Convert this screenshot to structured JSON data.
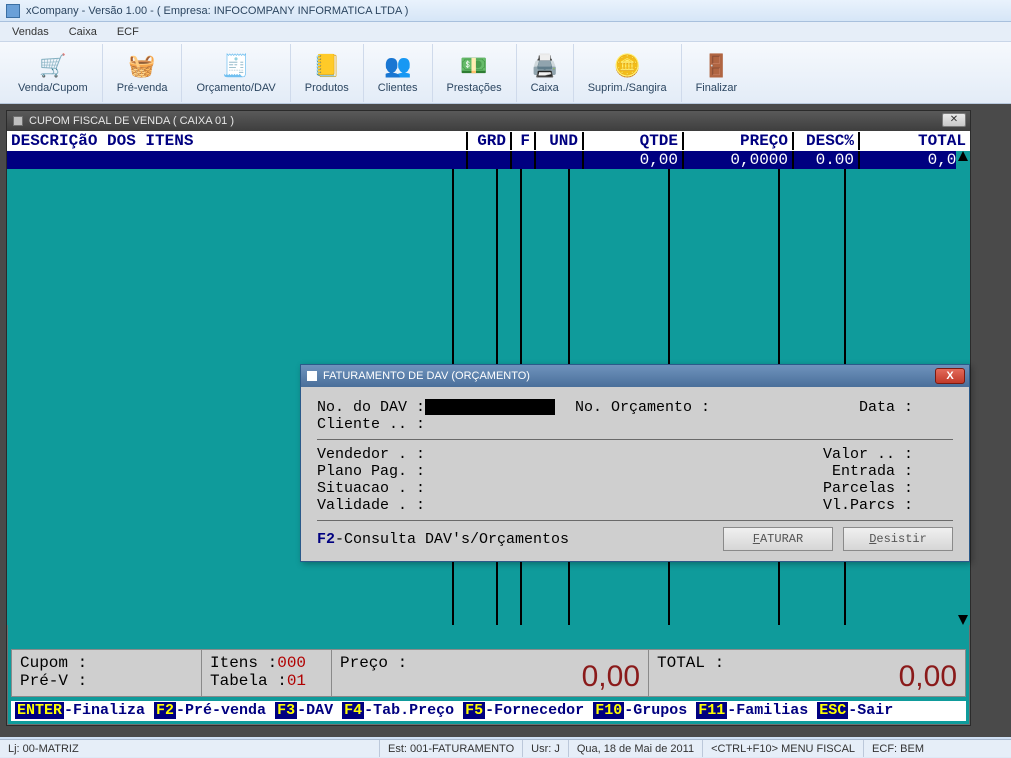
{
  "titlebar": "xCompany - Versão 1.00  -  ( Empresa: INFOCOMPANY INFORMATICA LTDA )",
  "menu": [
    "Vendas",
    "Caixa",
    "ECF"
  ],
  "toolbar": [
    {
      "label": "Venda/Cupom",
      "icon": "🛒"
    },
    {
      "label": "Pré-venda",
      "icon": "🧺"
    },
    {
      "label": "Orçamento/DAV",
      "icon": "🧾"
    },
    {
      "label": "Produtos",
      "icon": "📒"
    },
    {
      "label": "Clientes",
      "icon": "👥"
    },
    {
      "label": "Prestações",
      "icon": "💵"
    },
    {
      "label": "Caixa",
      "icon": "🖨️"
    },
    {
      "label": "Suprim./Sangira",
      "icon": "🪙"
    },
    {
      "label": "Finalizar",
      "icon": "🚪"
    }
  ],
  "fiscal": {
    "title": "CUPOM FISCAL DE VENDA    ( CAIXA 01 )",
    "headers": {
      "desc": "DESCRIÇãO DOS ITENS",
      "grd": "GRD",
      "f": "F",
      "und": "UND",
      "qtde": "QTDE",
      "preco": "PREÇO",
      "desc_pct": "DESC%",
      "total": "TOTAL"
    },
    "row0": {
      "qtde": "0,00",
      "preco": "0,0000",
      "desc_pct": "0.00",
      "total": "0,00"
    }
  },
  "bottom": {
    "cupom_lbl": "Cupom :",
    "prev_lbl": "Pré-V :",
    "itens_lbl": "Itens  :",
    "itens_val": "000",
    "tabela_lbl": "Tabela :",
    "tabela_val": "01",
    "preco_lbl": "Preço :",
    "preco_val": "0,00",
    "total_lbl": "TOTAL :",
    "total_val": "0,00"
  },
  "fkeys": [
    {
      "k": "ENTER",
      "t": "-Finaliza "
    },
    {
      "k": "F2",
      "t": "-Pré-venda "
    },
    {
      "k": "F3",
      "t": "-DAV "
    },
    {
      "k": "F4",
      "t": "-Tab.Preço "
    },
    {
      "k": "F5",
      "t": "-Fornecedor "
    },
    {
      "k": "F10",
      "t": "-Grupos "
    },
    {
      "k": "F11",
      "t": "-Familias "
    },
    {
      "k": "ESC",
      "t": "-Sair"
    }
  ],
  "status": {
    "lj": "Lj: 00-MATRIZ",
    "est": "Est: 001-FATURAMENTO",
    "usr": "Usr: J",
    "date": "Qua, 18 de Mai de 2011",
    "hint": "<CTRL+F10> MENU FISCAL",
    "ecf": "ECF: BEM"
  },
  "dialog": {
    "title": "FATURAMENTO DE DAV (ORÇAMENTO)",
    "l1a": "No. do DAV :",
    "l1b": "No. Orçamento :",
    "l1c": "Data :",
    "l2": "Cliente .. :",
    "l3a": "Vendedor . :",
    "l3b": "Valor .. :",
    "l4a": "Plano Pag. :",
    "l4b": "Entrada  :",
    "l5a": "Situacao . :",
    "l5b": "Parcelas :",
    "l6a": "Validade . :",
    "l6b": "Vl.Parcs :",
    "hint_key": "F2",
    "hint_txt": "-Consulta DAV's/Orçamentos",
    "btn_faturar": "FATURAR",
    "btn_desistir": "Desistir"
  }
}
